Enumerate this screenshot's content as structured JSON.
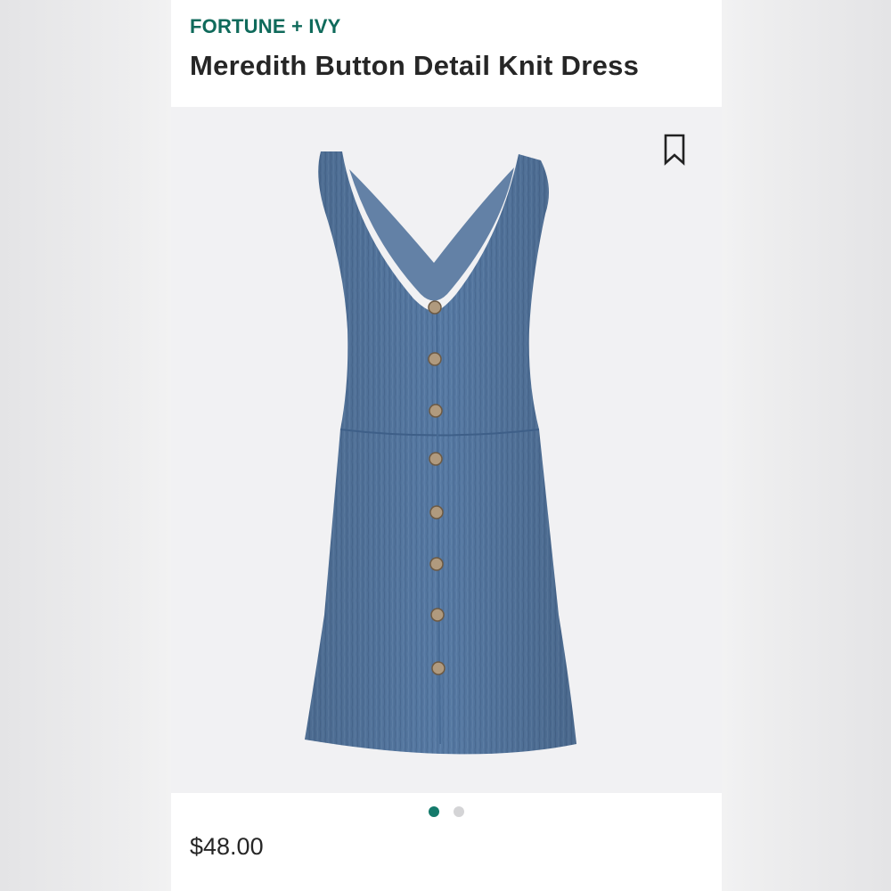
{
  "product": {
    "brand": "FORTUNE + IVY",
    "name": "Meredith Button Detail Knit Dress",
    "price": "$48.00",
    "image_alt": "Blue sleeveless knit dress with button front"
  },
  "carousel": {
    "total_images": 2,
    "active_index": 0
  },
  "icons": {
    "bookmark": "bookmark-icon"
  },
  "colors": {
    "brand": "#0f6a5b",
    "active_dot": "#147a6b",
    "inactive_dot": "#d4d4d6",
    "dress": "#5578a2"
  }
}
